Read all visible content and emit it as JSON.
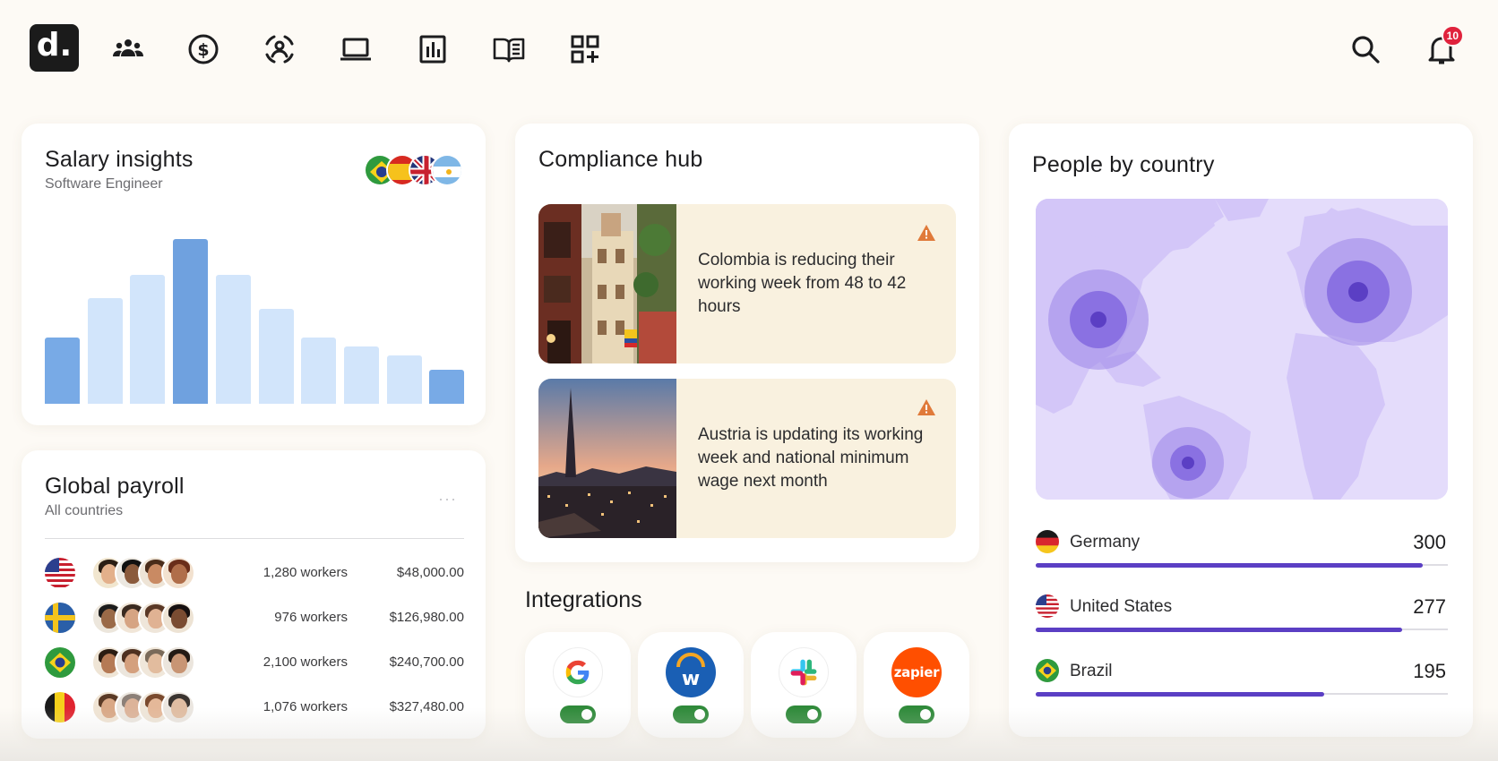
{
  "nav": {
    "logo": "d.",
    "notification_count": "10",
    "icons": [
      "people-icon",
      "dollar-icon",
      "person-scan-icon",
      "laptop-icon",
      "report-icon",
      "book-icon",
      "apps-add-icon"
    ]
  },
  "salary": {
    "title": "Salary insights",
    "subtitle": "Software Engineer",
    "flags": [
      "Brazil",
      "Spain",
      "United Kingdom",
      "Argentina"
    ],
    "bars": [
      {
        "value": 0.37,
        "highlight": "mid"
      },
      {
        "value": 0.59,
        "highlight": "light"
      },
      {
        "value": 0.72,
        "highlight": "light"
      },
      {
        "value": 0.92,
        "highlight": "dark"
      },
      {
        "value": 0.72,
        "highlight": "light"
      },
      {
        "value": 0.53,
        "highlight": "light"
      },
      {
        "value": 0.37,
        "highlight": "light"
      },
      {
        "value": 0.32,
        "highlight": "light"
      },
      {
        "value": 0.27,
        "highlight": "light"
      },
      {
        "value": 0.19,
        "highlight": "mid"
      }
    ],
    "colors": {
      "dark": "#6fa1df",
      "mid": "#78aae6",
      "light": "#d2e5fb"
    }
  },
  "payroll": {
    "title": "Global payroll",
    "subtitle": "All countries",
    "menu": "···",
    "rows": [
      {
        "country": "us",
        "workers": "1,280 workers",
        "amount": "$48,000.00"
      },
      {
        "country": "se",
        "workers": "976 workers",
        "amount": "$126,980.00"
      },
      {
        "country": "br",
        "workers": "2,100 workers",
        "amount": "$240,700.00"
      },
      {
        "country": "be",
        "workers": "1,076 workers",
        "amount": "$327,480.00"
      }
    ]
  },
  "compliance": {
    "title": "Compliance hub",
    "notices": [
      {
        "text": "Colombia is reducing their working week from 48 to 42 hours",
        "icon": "warning-icon"
      },
      {
        "text": "Austria is updating its working week and national minimum wage next month",
        "icon": "warning-icon"
      }
    ]
  },
  "integrations": {
    "title": "Integrations",
    "items": [
      {
        "name": "Google",
        "label": "G",
        "enabled": true
      },
      {
        "name": "Workday",
        "label": "w",
        "enabled": true
      },
      {
        "name": "Slack",
        "label": "",
        "enabled": true
      },
      {
        "name": "Zapier",
        "label": "zapier",
        "enabled": true
      }
    ]
  },
  "people": {
    "title": "People by country",
    "countries": [
      {
        "code": "de",
        "name": "Germany",
        "count": "300",
        "fraction": 0.94
      },
      {
        "code": "us",
        "name": "United States",
        "count": "277",
        "fraction": 0.89
      },
      {
        "code": "br",
        "name": "Brazil",
        "count": "195",
        "fraction": 0.7
      }
    ],
    "accent": "#5b3fc4"
  }
}
